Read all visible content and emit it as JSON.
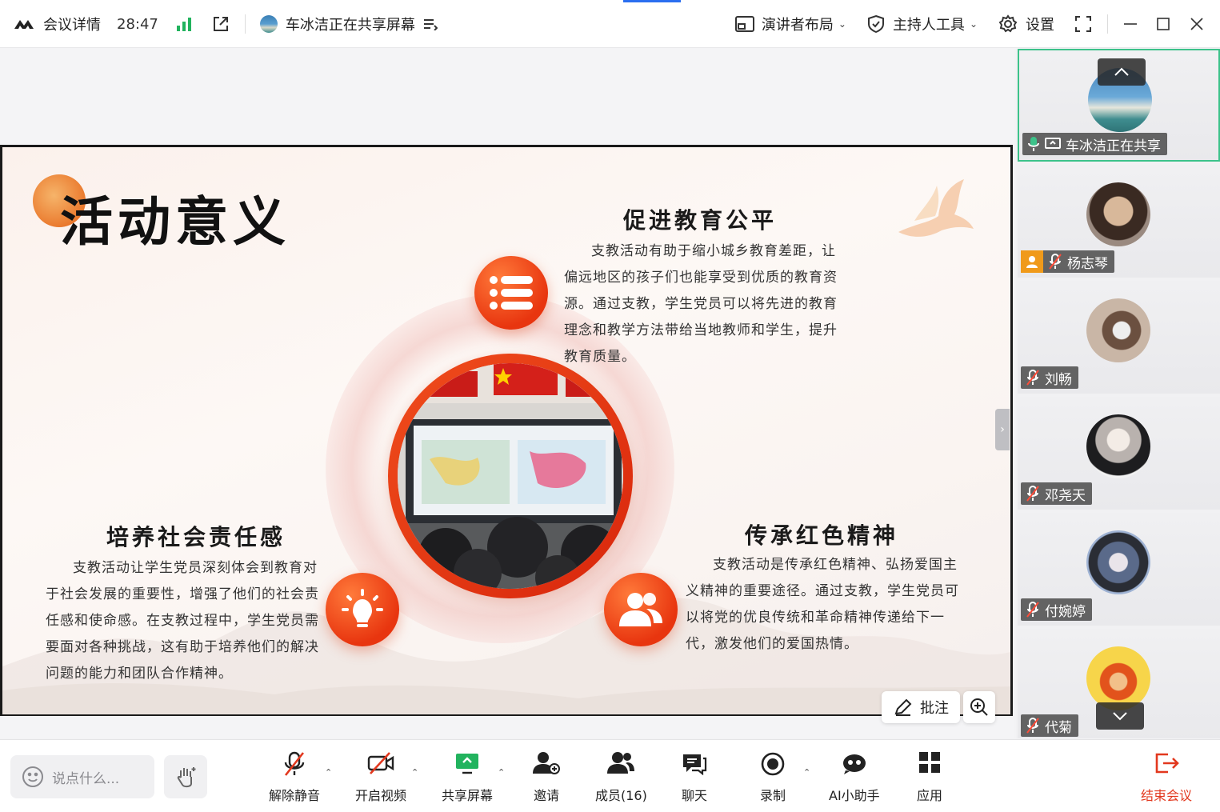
{
  "topbar": {
    "meeting_details": "会议详情",
    "timer": "28:47",
    "sharing_status": "车冰洁正在共享屏幕",
    "layout_label": "演讲者布局",
    "host_tools_label": "主持人工具",
    "settings_label": "设置"
  },
  "slide": {
    "title": "活动意义",
    "sections": [
      {
        "title": "促进教育公平",
        "body": "支教活动有助于缩小城乡教育差距，让偏远地区的孩子们也能享受到优质的教育资源。通过支教，学生党员可以将先进的教育理念和教学方法带给当地教师和学生，提升教育质量。"
      },
      {
        "title": "培养社会责任感",
        "body": "支教活动让学生党员深刻体会到教育对于社会发展的重要性，增强了他们的社会责任感和使命感。在支教过程中，学生党员需要面对各种挑战，这有助于培养他们的解决问题的能力和团队合作精神。"
      },
      {
        "title": "传承红色精神",
        "body": "支教活动是传承红色精神、弘扬爱国主义精神的重要途径。通过支教，学生党员可以将党的优良传统和革命精神传递给下一代，激发他们的爱国热情。"
      }
    ]
  },
  "stage": {
    "annotate_label": "批注"
  },
  "participants": [
    {
      "name": "车冰洁正在共享",
      "role": "sharer",
      "active": true
    },
    {
      "name": "杨志琴",
      "role": "host",
      "active": false
    },
    {
      "name": "刘畅",
      "role": "member",
      "active": false
    },
    {
      "name": "邓尧天",
      "role": "member",
      "active": false
    },
    {
      "name": "付婉婷",
      "role": "member",
      "active": false
    },
    {
      "name": "代菊",
      "role": "member",
      "active": false
    }
  ],
  "bottombar": {
    "chat_placeholder": "说点什么...",
    "unmute": "解除静音",
    "start_video": "开启视频",
    "share_screen": "共享屏幕",
    "invite": "邀请",
    "members": "成员(16)",
    "chat": "聊天",
    "record": "录制",
    "ai_assistant": "AI小助手",
    "apps": "应用",
    "end_meeting": "结束会议"
  },
  "colors": {
    "accent_blue": "#2a6ef0",
    "active_green": "#3cc28a",
    "end_red": "#e2381e",
    "orb_orange": "#e8350f",
    "host_orange": "#f09a1a"
  }
}
